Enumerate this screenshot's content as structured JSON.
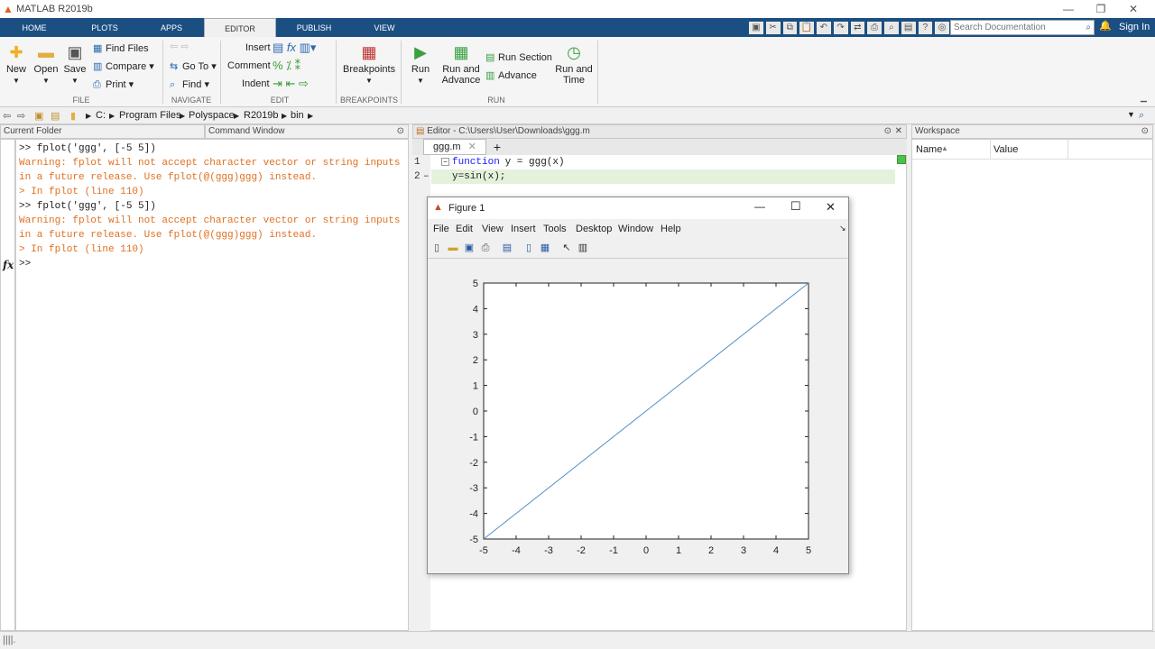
{
  "window": {
    "title": "MATLAB R2019b",
    "minimize": "—",
    "restore": "❐",
    "close": "✕"
  },
  "tabs": [
    "HOME",
    "PLOTS",
    "APPS",
    "EDITOR",
    "PUBLISH",
    "VIEW"
  ],
  "active_tab": "EDITOR",
  "search": {
    "placeholder": "Search Documentation"
  },
  "sign_in": "Sign In",
  "ribbon": {
    "file": {
      "new": "New",
      "open": "Open",
      "save": "Save",
      "find_files": "Find Files",
      "compare": "Compare",
      "print": "Print",
      "group": "FILE"
    },
    "navigate": {
      "go_to": "Go To",
      "find": "Find",
      "group": "NAVIGATE"
    },
    "edit": {
      "insert": "Insert",
      "comment": "Comment",
      "indent": "Indent",
      "group": "EDIT"
    },
    "breakpoints": {
      "label": "Breakpoints",
      "group": "BREAKPOINTS"
    },
    "run": {
      "run": "Run",
      "run_and_advance_1": "Run and",
      "run_and_advance_2": "Advance",
      "run_section": "Run Section",
      "advance": "Advance",
      "run_and_time_1": "Run and",
      "run_and_time_2": "Time",
      "group": "RUN"
    }
  },
  "address": {
    "drive": "C:",
    "parts": [
      "Program Files",
      "Polyspace",
      "R2019b",
      "bin"
    ]
  },
  "panes": {
    "current_folder": "Current Folder",
    "command_window": "Command Window",
    "editor": "Editor - C:\\Users\\User\\Downloads\\ggg.m",
    "workspace": "Workspace"
  },
  "command_window": {
    "lines": [
      ">> fplot('ggg', [-5 5])",
      "Warning: fplot will not accept character vector or string inputs",
      "in a future release. Use fplot(@(ggg)ggg) instead.",
      "> In fplot (line 110)",
      ">> fplot('ggg', [-5 5])",
      "Warning: fplot will not accept character vector or string inputs",
      "in a future release. Use fplot(@(ggg)ggg) instead.",
      "> In fplot (line 110)",
      ">>"
    ],
    "prompt_icon": "fx"
  },
  "editor": {
    "tab": "ggg.m",
    "line_numbers": [
      "1",
      "2"
    ],
    "lines": [
      {
        "kw": "function",
        "rest": " y = ggg(x)"
      },
      {
        "kw": "",
        "rest": "y=sin(x);"
      }
    ]
  },
  "workspace": {
    "columns": [
      "Name",
      "Value"
    ]
  },
  "figure": {
    "title": "Figure 1",
    "menu": [
      "File",
      "Edit",
      "View",
      "Insert",
      "Tools",
      "Desktop",
      "Window",
      "Help"
    ]
  },
  "chart_data": {
    "type": "line",
    "x": [
      -5,
      5
    ],
    "series": [
      {
        "values": [
          -5,
          5
        ],
        "color": "#4e8fc8"
      }
    ],
    "xlim": [
      -5,
      5
    ],
    "ylim": [
      -5,
      5
    ],
    "xticks": [
      "-5",
      "-4",
      "-3",
      "-2",
      "-1",
      "0",
      "1",
      "2",
      "3",
      "4",
      "5"
    ],
    "yticks": [
      "-5",
      "-4",
      "-3",
      "-2",
      "-1",
      "0",
      "1",
      "2",
      "3",
      "4",
      "5"
    ],
    "grid": false
  },
  "colors": {
    "tabbar": "#1b4f82",
    "warning": "#e07020",
    "line": "#4e8fc8"
  }
}
